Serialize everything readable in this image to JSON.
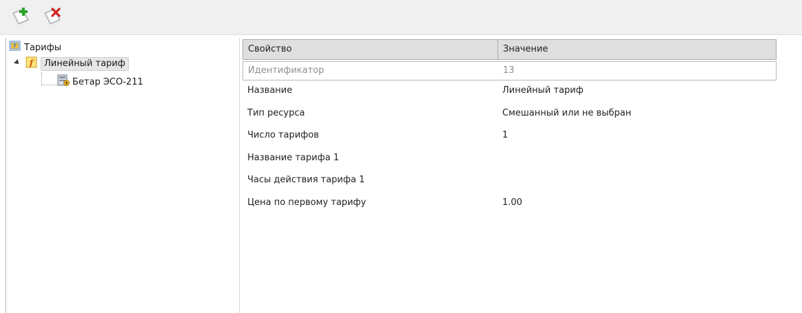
{
  "toolbar": {
    "add_icon": "add-document-icon",
    "delete_icon": "delete-document-icon"
  },
  "tree": {
    "root": {
      "label": "Тарифы",
      "icon": "tariffs-folder-icon"
    },
    "tariff": {
      "label": "Линейный тариф",
      "icon": "tariff-f-icon",
      "expanded": true,
      "selected": true
    },
    "device": {
      "label": "Бетар ЭСО-211",
      "icon": "meter-device-icon"
    }
  },
  "grid": {
    "headers": {
      "property": "Свойство",
      "value": "Значение"
    },
    "rows": [
      {
        "property": "Идентификатор",
        "value": "13",
        "readonly": true
      },
      {
        "property": "Название",
        "value": "Линейный тариф"
      },
      {
        "property": "Тип ресурса",
        "value": "Смешанный или не выбран"
      },
      {
        "property": "Число тарифов",
        "value": "1"
      },
      {
        "property": "Название тарифа 1",
        "value": ""
      },
      {
        "property": "Часы действия тарифа 1",
        "value": ""
      },
      {
        "property": "Цена по первому тарифу",
        "value": "1.00"
      }
    ]
  }
}
